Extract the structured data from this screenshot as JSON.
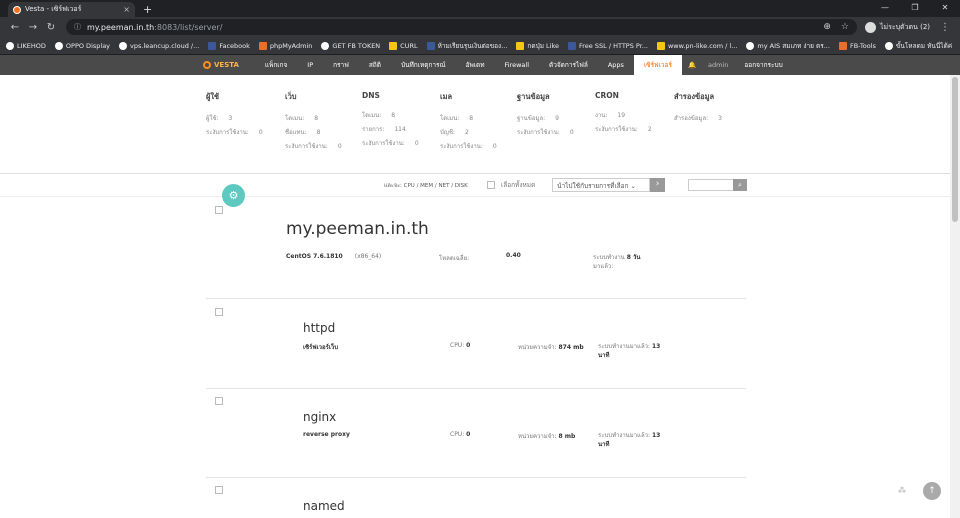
{
  "browser": {
    "tab_title": "Vesta - เซิร์ฟเวอร์",
    "tab_close": "×",
    "new_tab": "+",
    "url_host": "my.peeman.in.th",
    "url_path": ":8083/list/server/",
    "profile_name": "ไม่ระบุตัวตน (2)",
    "bookmarks": [
      "LIKEHOD",
      "OPPO Display",
      "vps.leancup.cloud /...",
      "Facebook",
      "phpMyAdmin",
      "GET FB TOKEN",
      "CURL",
      "ห้ามเรียนรุนเงินต่อของ...",
      "กดปุ่ม Like",
      "Free SSL / HTTPS Pr...",
      "www.pn-like.com / l...",
      "my AIS สมเภท ง่าย ตร...",
      "FB-Tools",
      "ขั้นโหลดม หันนี่ได้ค่"
    ],
    "bookmark_more": "»"
  },
  "vesta_nav": {
    "logo": "VESTA",
    "items": [
      "แพ็กเกจ",
      "IP",
      "กราฟ",
      "สถิติ",
      "บันทึกเหตุการณ์",
      "อัพเดท",
      "Firewall",
      "ตัวจัดการไฟล์",
      "Apps",
      "เซิร์ฟเวอร์"
    ],
    "active": "เซิร์ฟเวอร์",
    "user": "admin",
    "logout": "ออกจากระบบ"
  },
  "stats": [
    {
      "head": "ผู้ใช้",
      "rows": [
        [
          "ผู้ใช้:",
          "3"
        ],
        [
          "ระงับการใช้งาน:",
          "0"
        ]
      ]
    },
    {
      "head": "เว็บ",
      "rows": [
        [
          "โดเมน:",
          "8"
        ],
        [
          "ชื่อแทน:",
          "8"
        ],
        [
          "ระงับการใช้งาน:",
          "0"
        ]
      ]
    },
    {
      "head": "DNS",
      "rows": [
        [
          "โดเมน:",
          "8"
        ],
        [
          "รายการ:",
          "114"
        ],
        [
          "ระงับการใช้งาน:",
          "0"
        ]
      ]
    },
    {
      "head": "เมล",
      "rows": [
        [
          "โดเมน:",
          "8"
        ],
        [
          "บัญชี:",
          "2"
        ],
        [
          "ระงับการใช้งาน:",
          "0"
        ]
      ]
    },
    {
      "head": "ฐานข้อมูล",
      "rows": [
        [
          "ฐานข้อมูล:",
          "9"
        ],
        [
          "ระงับการใช้งาน:",
          "0"
        ]
      ]
    },
    {
      "head": "CRON",
      "rows": [
        [
          "งาน:",
          "19"
        ],
        [
          "ระงับการใช้งาน:",
          "2"
        ]
      ]
    },
    {
      "head": "สำรองข้อมูล",
      "rows": [
        [
          "สำรองข้อมูล:",
          "3"
        ]
      ]
    }
  ],
  "toolbar": {
    "sort_by": "และจะ: CPU / MEM / NET / DISK",
    "select_all": "เลือกทั้งหมด",
    "action_select": "นำไปใช้กับรายการที่เลือก ⌄",
    "apply": "›",
    "search_icon_glyph": "🔍"
  },
  "host": {
    "name": "my.peeman.in.th",
    "os": "CentOS 7.6.1810",
    "arch": "(x86_64)",
    "load_label": "โหลดเฉลี่ย:",
    "load_value": "0.40",
    "uptime_label": "ระบบทำงาน",
    "uptime_value": "8 วัน",
    "uptime_suffix": "มาแล้ว:"
  },
  "services": [
    {
      "name": "httpd",
      "desc": "เซิร์ฟเวอร์เว็บ",
      "cpu_label": "CPU:",
      "cpu": "0",
      "mem_label": "หน่วยความจำ:",
      "mem": "874 mb",
      "uptime_label": "ระบบทำงานมาแล้ว:",
      "uptime": "13",
      "uptime_unit": "นาที"
    },
    {
      "name": "nginx",
      "desc": "reverse proxy",
      "cpu_label": "CPU:",
      "cpu": "0",
      "mem_label": "หน่วยความจำ:",
      "mem": "8 mb",
      "uptime_label": "ระบบทำงานมาแล้ว:",
      "uptime": "13",
      "uptime_unit": "นาที"
    },
    {
      "name": "named"
    }
  ]
}
